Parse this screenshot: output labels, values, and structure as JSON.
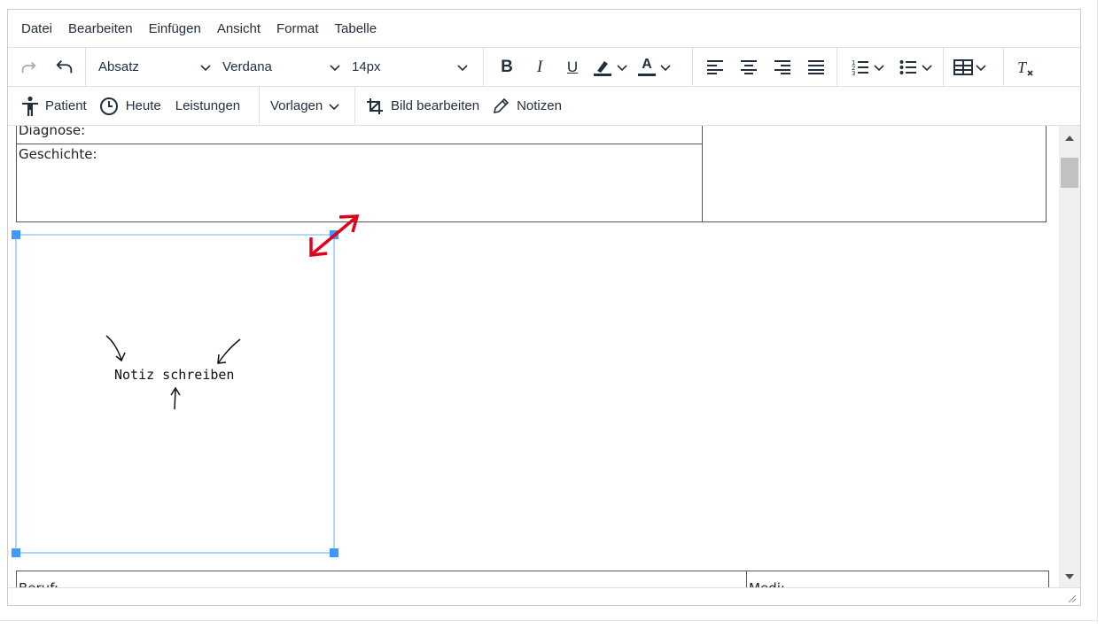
{
  "menubar": {
    "items": [
      "Datei",
      "Bearbeiten",
      "Einfügen",
      "Ansicht",
      "Format",
      "Tabelle"
    ]
  },
  "toolbar": {
    "block_format": "Absatz",
    "font_family": "Verdana",
    "font_size": "14px",
    "bold_label": "B",
    "italic_label": "I",
    "underline_label": "U",
    "text_color_label": "A"
  },
  "toolbar2": {
    "patient_label": "Patient",
    "today_label": "Heute",
    "services_label": "Leistungen",
    "templates_label": "Vorlagen",
    "edit_image_label": "Bild bearbeiten",
    "notes_label": "Notizen"
  },
  "document": {
    "diagnosis_label": "Diagnose:",
    "history_label": "Geschichte:",
    "job_label": "Beruf:",
    "meds_label": "Medi:",
    "image_text": "Notiz schreiben"
  },
  "colors": {
    "selection_border": "#b4d7ff",
    "handle": "#4099ff",
    "annotation_arrow": "#e0001b"
  },
  "icons": [
    "redo-icon",
    "undo-icon",
    "patient-icon",
    "clock-icon",
    "crop-icon",
    "pencil-icon",
    "chevron-down-icon",
    "align-left-icon",
    "align-center-icon",
    "align-right-icon",
    "justify-icon",
    "numbered-list-icon",
    "bullet-list-icon",
    "table-icon",
    "clear-format-icon",
    "highlight-icon",
    "resize-arrow-icon"
  ]
}
